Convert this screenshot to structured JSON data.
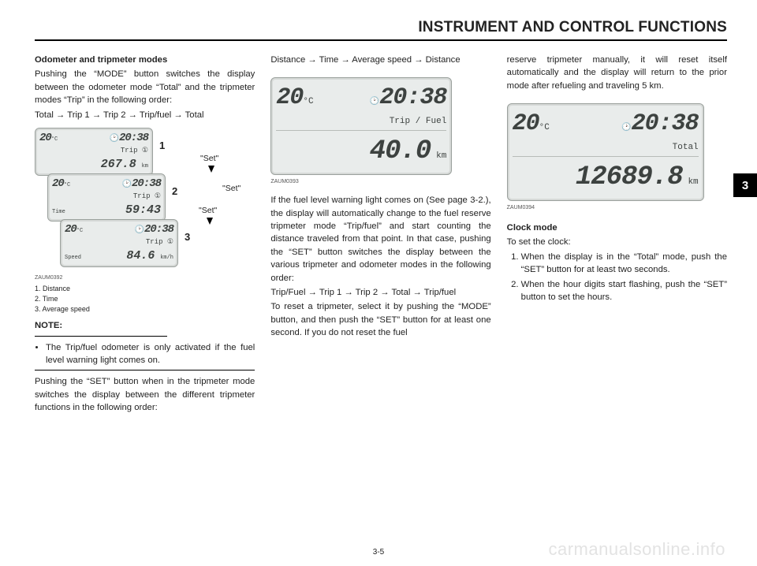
{
  "header": {
    "title": "INSTRUMENT AND CONTROL FUNCTIONS"
  },
  "chapter_tab": "3",
  "page_number": "3-5",
  "watermark": "carmanualsonline.info",
  "col1": {
    "h1": "Odometer and tripmeter modes",
    "p1": "Pushing the “MODE” button switches the display between the odometer mode “Total” and the tripmeter modes “Trip” in the following order:",
    "p2": "Total → Trip 1 → Trip 2  → Trip/fuel → Total",
    "fig": {
      "code": "ZAUM0392",
      "callouts": {
        "n1": "1",
        "n2": "2",
        "n3": "3"
      },
      "set_labels": {
        "a": "\"Set\"",
        "b": "\"Set\"",
        "c": "\"Set\""
      },
      "panel1": {
        "temp": "20",
        "temp_unit": "°C",
        "clock": "20:38",
        "mode": "Trip",
        "sub": "①",
        "value": "267.8",
        "unit": "km"
      },
      "panel2": {
        "temp": "20",
        "temp_unit": "°C",
        "clock": "20:38",
        "mode": "Trip",
        "sub": "①",
        "left": "Time",
        "value": "59:43"
      },
      "panel3": {
        "temp": "20",
        "temp_unit": "°C",
        "clock": "20:38",
        "mode": "Trip",
        "sub": "①",
        "left": "Speed",
        "value": "84.6",
        "unit": "km/h"
      }
    },
    "caption": {
      "l1": "1. Distance",
      "l2": "2. Time",
      "l3": "3. Average speed"
    },
    "note_label": "NOTE:",
    "note_item": "The Trip/fuel odometer is only activated if the fuel level warning light comes on.",
    "p3": "Pushing the “SET” button when in the tripmeter mode switches the display between the different tripmeter functions in the following order:"
  },
  "col2": {
    "p1": "Distance → Time → Average speed → Distance",
    "fig": {
      "code": "ZAUM0393",
      "temp": "20",
      "temp_unit": "°C",
      "clock": "20:38",
      "mode": "Trip / Fuel",
      "value": "40.0",
      "unit": "km"
    },
    "p2": "If the fuel level warning light comes on (See page 3-2.), the display will automatically change to the fuel reserve tripmeter mode “Trip/fuel” and start counting the distance traveled from that point. In that case, pushing the “SET” button switches the display between the various tripmeter and odometer modes in the following order:",
    "p3": "Trip/Fuel  → Trip 1 → Trip 2 → Total → Trip/fuel",
    "p4": "To reset a tripmeter, select it by pushing the “MODE” button, and then push the “SET” button for at least one second. If you do not reset the fuel"
  },
  "col3": {
    "p1": "reserve tripmeter manually, it will reset itself automatically and the display will return to the prior mode after refueling and traveling 5 km.",
    "fig": {
      "code": "ZAUM0394",
      "temp": "20",
      "temp_unit": "°C",
      "clock": "20:38",
      "mode": "Total",
      "value": "12689.8",
      "unit": "km"
    },
    "h2": "Clock mode",
    "p2": "To set the clock:",
    "step1": "When the display is in the “Total” mode, push the “SET” button for at least two seconds.",
    "step2": "When the hour digits start flashing, push the “SET” button to set the hours."
  }
}
